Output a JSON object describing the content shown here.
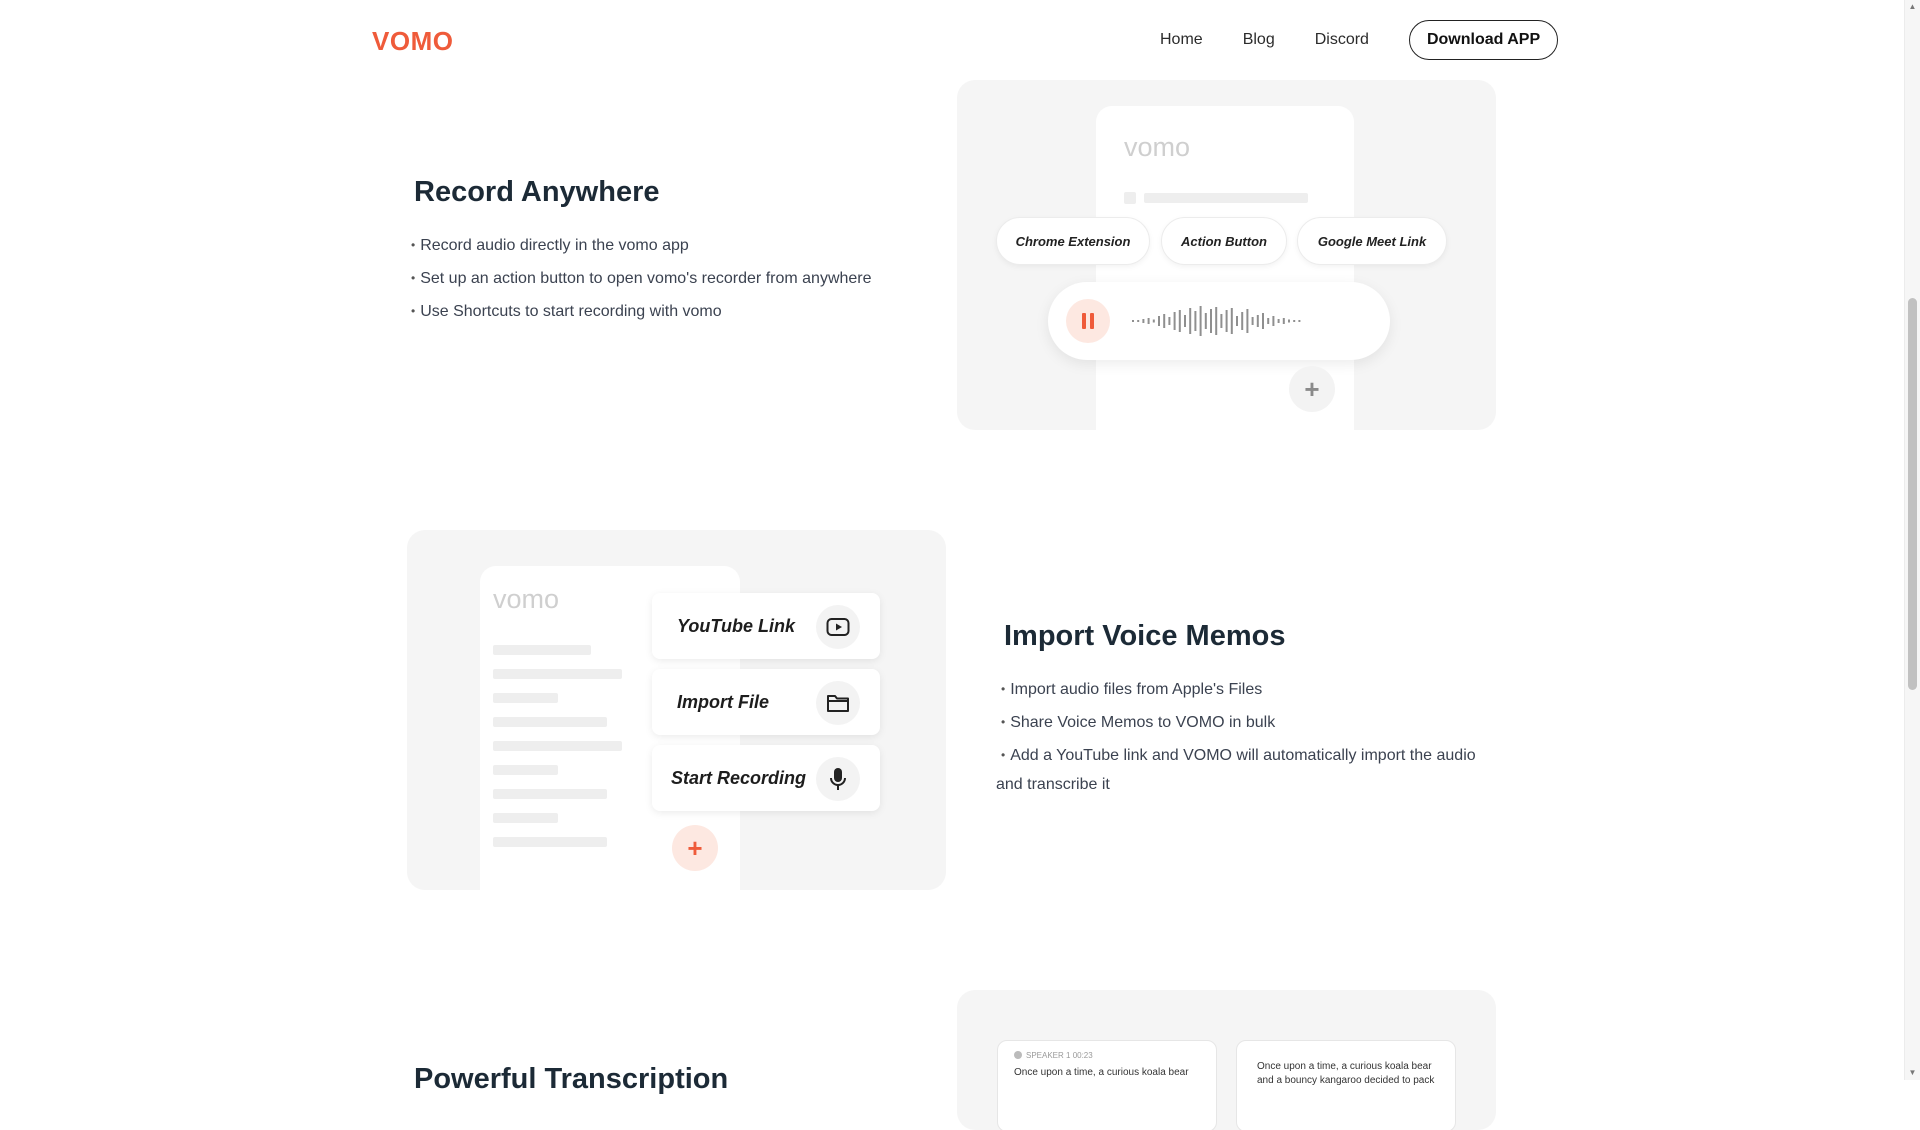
{
  "header": {
    "logo": "VOMO",
    "nav": [
      "Home",
      "Blog",
      "Discord"
    ],
    "download_label": "Download APP"
  },
  "section1": {
    "title": "Record Anywhere",
    "bullets": [
      "Record audio directly in the vomo app",
      "Set up an action button to open vomo's recorder from anywhere",
      "Use Shortcuts to start recording with vomo"
    ],
    "mockup": {
      "brand": "vomo",
      "chips": [
        "Chrome Extension",
        "Action Button",
        "Google Meet Link"
      ],
      "plus": "+"
    }
  },
  "section2": {
    "title": "Import Voice Memos",
    "bullets": [
      "Import audio files from Apple's Files",
      "Share Voice Memos to VOMO in bulk",
      "Add a YouTube link and VOMO will automatically import the audio"
    ],
    "bullet_continuation": "and transcribe it",
    "mockup": {
      "brand": "vomo",
      "options": [
        {
          "label": "YouTube Link",
          "icon": "youtube-icon"
        },
        {
          "label": "Import File",
          "icon": "folder-icon"
        },
        {
          "label": "Start Recording",
          "icon": "microphone-icon"
        }
      ],
      "plus": "+"
    }
  },
  "section3": {
    "title": "Powerful Transcription",
    "card1": {
      "speaker": "SPEAKER 1  00:23",
      "text": "Once upon a time, a curious koala bear"
    },
    "card2": {
      "text1": "Once upon a time, a curious koala bear",
      "text2": "and a bouncy kangaroo decided to pack"
    }
  },
  "colors": {
    "brand": "#ef5b3a",
    "panel": "#f5f5f5",
    "heading": "#1c2a36"
  }
}
